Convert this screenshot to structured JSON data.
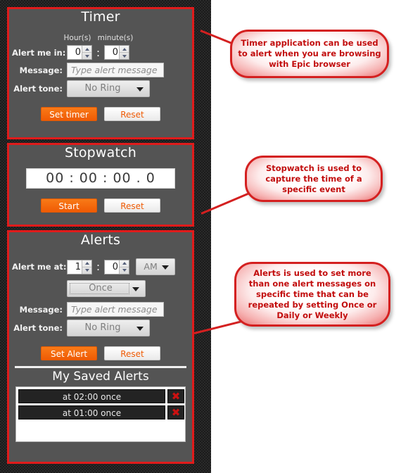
{
  "timer": {
    "title": "Timer",
    "column_heads": [
      "Hour(s)",
      "minute(s)"
    ],
    "alert_label": "Alert me in:",
    "hours_value": "0",
    "minutes_value": "0",
    "separator": ":",
    "message_label": "Message:",
    "message_placeholder": "Type alert message",
    "tone_label": "Alert tone:",
    "tone_value": "No Ring",
    "set_button": "Set timer",
    "reset_button": "Reset"
  },
  "stopwatch": {
    "title": "Stopwatch",
    "display": "00 : 00 : 00 . 0",
    "start_button": "Start",
    "reset_button": "Reset"
  },
  "alerts": {
    "title": "Alerts",
    "alert_label": "Alert me at:",
    "hours_value": "1",
    "minutes_value": "0",
    "separator": ":",
    "ampm_value": "AM",
    "repeat_value": "Once",
    "message_label": "Message:",
    "message_placeholder": "Type alert message",
    "tone_label": "Alert tone:",
    "tone_value": "No Ring",
    "set_button": "Set Alert",
    "reset_button": "Reset",
    "saved_title": "My Saved Alerts",
    "saved_items": [
      {
        "text": "at 02:00  once",
        "delete_icon": "close-icon"
      },
      {
        "text": "at 01:00  once",
        "delete_icon": "close-icon"
      }
    ]
  },
  "callouts": {
    "timer": "Timer application can be used to alert when you are browsing with Epic browser",
    "stopwatch": "Stopwatch is used to capture the time of a specific event",
    "alerts": "Alerts is used to set more than one alert messages on specific time that can be repeated by setting Once or Daily or Weekly"
  },
  "colors": {
    "panel_border": "#e01b1b",
    "panel_bg": "#545454",
    "accent_orange": "#ef5b05",
    "callout_border": "#d42020",
    "callout_text": "#c20d0d"
  }
}
